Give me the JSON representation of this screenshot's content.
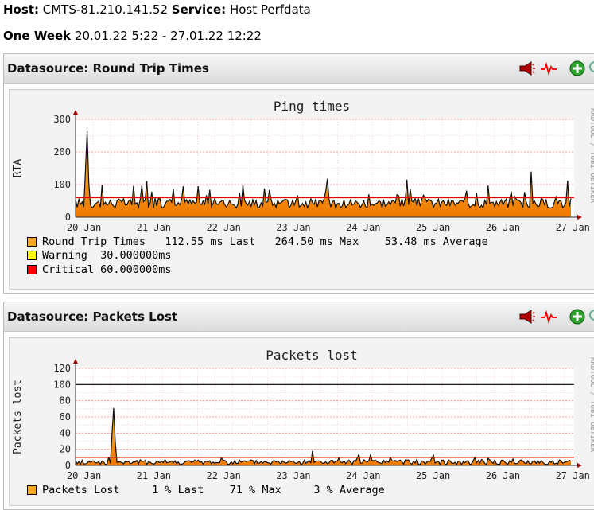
{
  "header": {
    "host_label": "Host:",
    "host_value": "CMTS-81.210.141.52",
    "service_label": "Service:",
    "service_value": "Host Perfdata",
    "period_label": "One Week",
    "period_value": "20.01.22 5:22 - 27.01.22 12:22"
  },
  "panels": [
    {
      "title": "Datasource: Round Trip Times",
      "tools": [
        "alert-horn-icon",
        "heartbeat-icon",
        "add-icon",
        "zoom-icon"
      ]
    },
    {
      "title": "Datasource: Packets Lost",
      "tools": [
        "alert-horn-icon",
        "heartbeat-icon",
        "add-icon",
        "zoom-icon"
      ]
    }
  ],
  "rrd_watermark": "RRDTOOL / TOBI OETIKER",
  "colors": {
    "area": "#f5a623",
    "area_dark": "#e0860a",
    "warning": "#ffff00",
    "critical": "#ff0000",
    "grid": "#ff9999"
  },
  "chart_data": [
    {
      "type": "area",
      "title": "Ping times",
      "ylabel": "RTA",
      "xlabel": "",
      "ylim": [
        0,
        300
      ],
      "yticks": [
        "0",
        "100",
        "200",
        "300"
      ],
      "xticks": [
        "20 Jan",
        "21 Jan",
        "22 Jan",
        "23 Jan",
        "24 Jan",
        "25 Jan",
        "26 Jan",
        "27 Jan"
      ],
      "threshold": {
        "name": "Critical",
        "value": 60
      },
      "series": [
        {
          "name": "Round Trip Times",
          "x": [
            "20 Jan 05:22",
            "20 Jan 12:00",
            "21 Jan 00:00",
            "21 Jan 12:00",
            "22 Jan 00:00",
            "22 Jan 12:00",
            "23 Jan 00:00",
            "23 Jan 12:00",
            "24 Jan 00:00",
            "24 Jan 12:00",
            "25 Jan 00:00",
            "25 Jan 12:00",
            "26 Jan 00:00",
            "26 Jan 12:00",
            "27 Jan 00:00",
            "27 Jan 12:22"
          ],
          "values": [
            35,
            264,
            65,
            60,
            55,
            50,
            58,
            60,
            110,
            65,
            70,
            60,
            55,
            140,
            60,
            112
          ]
        }
      ],
      "legend": [
        {
          "swatch": "#f5a623",
          "text": "Round Trip Times   112.55 ms Last   264.50 ms Max    53.48 ms Average"
        },
        {
          "swatch": "#ffff00",
          "text": "Warning  30.000000ms"
        },
        {
          "swatch": "#ff0000",
          "text": "Critical 60.000000ms"
        }
      ]
    },
    {
      "type": "area",
      "title": "Packets lost",
      "ylabel": "Packets lost",
      "xlabel": "",
      "ylim": [
        0,
        120
      ],
      "yticks": [
        "0",
        "20",
        "40",
        "60",
        "80",
        "100",
        "120"
      ],
      "xticks": [
        "20 Jan",
        "21 Jan",
        "22 Jan",
        "23 Jan",
        "24 Jan",
        "25 Jan",
        "26 Jan",
        "27 Jan"
      ],
      "threshold": {
        "name": "Critical",
        "value": 10
      },
      "reference_line": 100,
      "series": [
        {
          "name": "Packets Lost",
          "x": [
            "20 Jan 05:22",
            "20 Jan 12:00",
            "20 Jan 18:00",
            "21 Jan 00:00",
            "22 Jan 00:00",
            "23 Jan 00:00",
            "24 Jan 00:00",
            "24 Jan 12:00",
            "25 Jan 00:00",
            "26 Jan 00:00",
            "27 Jan 00:00",
            "27 Jan 12:22"
          ],
          "values": [
            3,
            5,
            71,
            5,
            8,
            6,
            10,
            8,
            12,
            6,
            6,
            1
          ]
        }
      ],
      "legend": [
        {
          "swatch": "#f5a623",
          "text": "Packets Lost     1 % Last    71 % Max     3 % Average"
        }
      ]
    }
  ]
}
